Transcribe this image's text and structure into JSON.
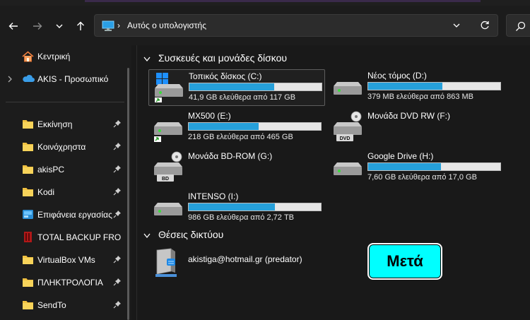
{
  "address": {
    "crumb": "Αυτός ο υπολογιστής"
  },
  "sidebar": {
    "items": [
      {
        "label": "Κεντρική",
        "icon": "home-icon"
      },
      {
        "label": "AKIS - Προσωπικό",
        "icon": "onedrive-cloud-icon"
      },
      {
        "label": "Εκκίνηση",
        "icon": "folder-icon"
      },
      {
        "label": "Κοινόχρηστα",
        "icon": "folder-icon"
      },
      {
        "label": "akisPC",
        "icon": "folder-icon"
      },
      {
        "label": "Kodi",
        "icon": "folder-icon"
      },
      {
        "label": "Επιφάνεια εργασίας",
        "icon": "desktop-icon"
      },
      {
        "label": "TOTAL BACKUP FRO",
        "icon": "backup-app-icon"
      },
      {
        "label": "VirtualBox VMs",
        "icon": "folder-icon"
      },
      {
        "label": "ΠΛΗΚΤΡΟΛΟΓΙΑ",
        "icon": "folder-icon"
      },
      {
        "label": "SendTo",
        "icon": "folder-icon"
      }
    ]
  },
  "sections": {
    "devices": "Συσκευές και μονάδες δίσκου",
    "network": "Θέσεις δικτύου"
  },
  "drives": [
    {
      "name": "Τοπικός δίσκος (C:)",
      "free": "41,9 GB ελεύθερα από 117 GB",
      "used_fraction": 0.64,
      "type": "windows-system",
      "selected": true
    },
    {
      "name": "Νέος τόμος (D:)",
      "free": "379 MB ελεύθερα από 863 MB",
      "used_fraction": 0.56,
      "type": "hdd"
    },
    {
      "name": "MX500 (E:)",
      "free": "218 GB ελεύθερα από 465 GB",
      "used_fraction": 0.53,
      "type": "hdd-shortcut"
    },
    {
      "name": "Μονάδα DVD RW (F:)",
      "free": "",
      "type": "dvd",
      "badge": "DVD"
    },
    {
      "name": "Μονάδα BD-ROM (G:)",
      "free": "",
      "type": "bd",
      "badge": "BD"
    },
    {
      "name": "Google Drive (H:)",
      "free": "7,60 GB ελεύθερα από 17,0 GB",
      "used_fraction": 0.55,
      "type": "hdd"
    },
    {
      "name": "INTENSO (I:)",
      "free": "986 GB ελεύθερα από 2,72 TB",
      "used_fraction": 0.65,
      "type": "hdd"
    }
  ],
  "network": {
    "location": "akistiga@hotmail.gr (predator)"
  },
  "overlay_button": {
    "label": "Μετά",
    "color": "#00ffff"
  },
  "colors": {
    "bar_fill": "#26a0da",
    "folder": "#f0c040"
  }
}
